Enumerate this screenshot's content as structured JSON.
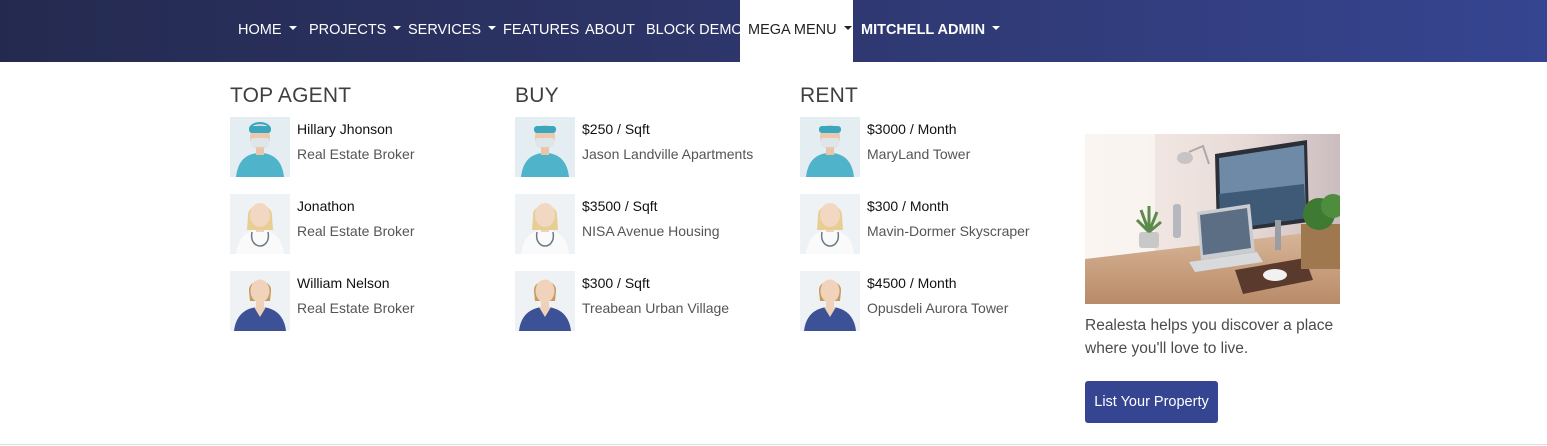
{
  "nav": {
    "items": [
      {
        "label": "HOME",
        "caret": true
      },
      {
        "label": "PROJECTS",
        "caret": true
      },
      {
        "label": "SERVICES",
        "caret": true
      },
      {
        "label": "FEATURES",
        "caret": false
      },
      {
        "label": "ABOUT",
        "caret": false
      },
      {
        "label": "BLOCK DEMO",
        "caret": false
      },
      {
        "label": "MEGA MENU",
        "caret": true,
        "active": true
      },
      {
        "label": "MITCHELL ADMIN",
        "caret": true
      }
    ]
  },
  "mega_menu": {
    "columns": [
      {
        "title": "TOP AGENT",
        "items": [
          {
            "title": "Hillary Jhonson",
            "subtitle": "Real Estate Broker",
            "avatar": "surgeon-avatar"
          },
          {
            "title": "Jonathon",
            "subtitle": "Real Estate Broker",
            "avatar": "doctor-avatar"
          },
          {
            "title": "William Nelson",
            "subtitle": "Real Estate Broker",
            "avatar": "nurse-avatar"
          }
        ]
      },
      {
        "title": "BUY",
        "items": [
          {
            "title": "$250 / Sqft",
            "subtitle": "Jason Landville Apartments",
            "avatar": "surgeon-avatar"
          },
          {
            "title": "$3500 / Sqft",
            "subtitle": "NISA Avenue Housing",
            "avatar": "doctor-avatar"
          },
          {
            "title": "$300 / Sqft",
            "subtitle": "Treabean Urban Village",
            "avatar": "nurse-avatar"
          }
        ]
      },
      {
        "title": "RENT",
        "items": [
          {
            "title": "$3000 / Month",
            "subtitle": "MaryLand Tower",
            "avatar": "surgeon-avatar"
          },
          {
            "title": "$300 / Month",
            "subtitle": "Mavin-Dormer Skyscraper",
            "avatar": "doctor-avatar"
          },
          {
            "title": "$4500 / Month",
            "subtitle": "Opusdeli Aurora Tower",
            "avatar": "nurse-avatar"
          }
        ]
      }
    ],
    "promo": {
      "image": "desk-workspace-photo",
      "text": "Realesta helps you discover a place where you'll love to live.",
      "button_label": "List Your Property"
    }
  },
  "colors": {
    "nav_gradient_start": "#242a4f",
    "nav_gradient_end": "#364591",
    "button": "#364591",
    "text_muted": "#555555"
  }
}
